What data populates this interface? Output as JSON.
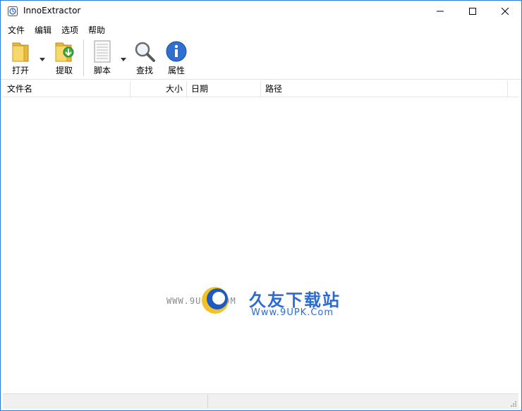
{
  "window": {
    "title": "InnoExtractor",
    "controls": {
      "minimize_icon": "minimize-icon",
      "maximize_icon": "maximize-icon",
      "close_icon": "close-icon"
    }
  },
  "menu": {
    "items": [
      {
        "label": "文件"
      },
      {
        "label": "编辑"
      },
      {
        "label": "选项"
      },
      {
        "label": "帮助"
      }
    ]
  },
  "toolbar": {
    "open_label": "打开",
    "extract_label": "提取",
    "script_label": "脚本",
    "find_label": "查找",
    "properties_label": "属性"
  },
  "table": {
    "columns": [
      {
        "label": "文件名"
      },
      {
        "label": "大小"
      },
      {
        "label": "日期"
      },
      {
        "label": "路径"
      }
    ],
    "rows": []
  },
  "watermark": {
    "small_text": "WWW.9UPK.COM",
    "brand": "久友下载站",
    "url": "Www.9UPK.Com"
  },
  "colors": {
    "window_border": "#2b79d8",
    "brand_blue": "#2a6bd6",
    "statusbar_bg": "#f0f0f0"
  }
}
